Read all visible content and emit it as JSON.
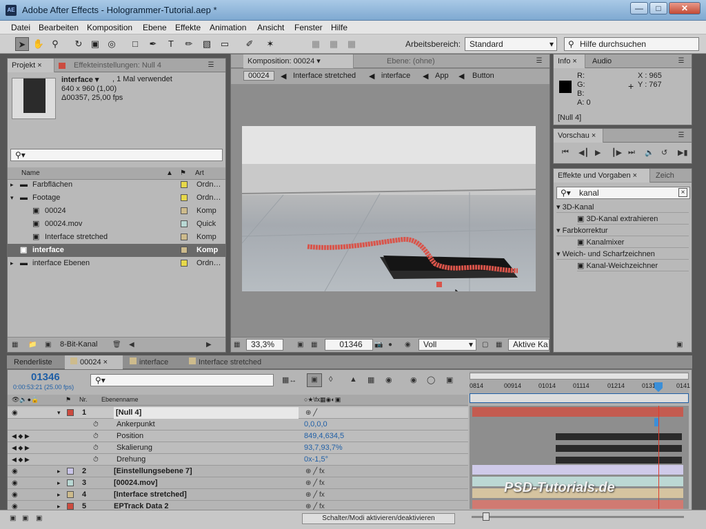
{
  "window": {
    "title": "Adobe After Effects - Hologrammer-Tutorial.aep *",
    "icon_text": "AE"
  },
  "menu": [
    "Datei",
    "Bearbeiten",
    "Komposition",
    "Ebene",
    "Effekte",
    "Animation",
    "Ansicht",
    "Fenster",
    "Hilfe"
  ],
  "toolbar": {
    "workspace_label": "Arbeitsbereich:",
    "workspace_value": "Standard",
    "help_placeholder": "Hilfe durchsuchen"
  },
  "project": {
    "tab_label": "Projekt",
    "effects_tab_label": "Effekteinstellungen: Null 4",
    "item_name": "interface ▾",
    "item_usage": ", 1 Mal verwendet",
    "item_dims": "640 x 960 (1,00)",
    "item_duration": "Δ00357, 25,00 fps",
    "search_placeholder": "",
    "col_name": "Name",
    "col_type": "Art",
    "rows": [
      {
        "label": "Farbflächen",
        "type": "Ordn…",
        "color": "#e6d84a"
      },
      {
        "label": "Footage",
        "type": "Ordn…",
        "color": "#e6d84a"
      },
      {
        "label": "00024",
        "type": "Komp",
        "color": "#cdbb8c"
      },
      {
        "label": "00024.mov",
        "type": "Quick",
        "color": "#b9d8d4"
      },
      {
        "label": "Interface stretched",
        "type": "Komp",
        "color": "#cdbb8c"
      },
      {
        "label": "interface",
        "type": "Komp",
        "color": "#cdbb8c"
      },
      {
        "label": "interface Ebenen",
        "type": "Ordn…",
        "color": "#e6d84a"
      }
    ],
    "footer_bitdepth": "8-Bit-Kanal"
  },
  "composition": {
    "tab_label": "Komposition: 00024",
    "layer_tab_label": "Ebene: (ohne)",
    "breadcrumb": [
      "00024",
      "Interface stretched",
      "interface",
      "App",
      "Button"
    ],
    "zoom": "33,3%",
    "timecode": "01346",
    "quality": "Voll",
    "camera": "Aktive Ka"
  },
  "info": {
    "tab_label": "Info",
    "audio_tab_label": "Audio",
    "r_label": "R:",
    "g_label": "G:",
    "b_label": "B:",
    "a_label": "A: 0",
    "x_label": "X : 965",
    "y_label": "Y : 767",
    "layer": "[Null 4]"
  },
  "preview": {
    "tab_label": "Vorschau"
  },
  "effects": {
    "tab_label": "Effekte und Vorgaben",
    "second_tab_label": "Zeich",
    "search_value": "kanal",
    "tree": [
      {
        "label": "3D-Kanal",
        "kind": "group"
      },
      {
        "label": "3D-Kanal extrahieren",
        "kind": "item"
      },
      {
        "label": "Farbkorrektur",
        "kind": "group"
      },
      {
        "label": "Kanalmixer",
        "kind": "item"
      },
      {
        "label": "Weich- und Scharfzeichnen",
        "kind": "group"
      },
      {
        "label": "Kanal-Weichzeichner",
        "kind": "item"
      }
    ]
  },
  "timeline_tabs": [
    "Renderliste",
    "00024",
    "interface",
    "Interface stretched"
  ],
  "timeline": {
    "timecode": "01346",
    "subtime": "0:00:53:21 (25.00 fps)",
    "col_nr": "Nr.",
    "col_name": "Ebenenname",
    "ruler": [
      "0814",
      "00914",
      "01014",
      "01114",
      "01214",
      "01314",
      "0141"
    ],
    "layers": [
      {
        "nr": "1",
        "name": "[Null 4]",
        "color": "#cc4b3f"
      },
      {
        "nr": "",
        "name": "Ankerpunkt",
        "value": "0,0,0,0",
        "prop": true
      },
      {
        "nr": "",
        "name": "Position",
        "value": "849,4,634,5",
        "prop": true
      },
      {
        "nr": "",
        "name": "Skalierung",
        "value": "93,7,93,7%",
        "prop": true
      },
      {
        "nr": "",
        "name": "Drehung",
        "value": "0x-1,5°",
        "prop": true
      },
      {
        "nr": "2",
        "name": "[Einstellungsebene 7]",
        "color": "#c9c4e8"
      },
      {
        "nr": "3",
        "name": "[00024.mov]",
        "color": "#b9d8d4"
      },
      {
        "nr": "4",
        "name": "[Interface stretched]",
        "color": "#cdbb8c"
      },
      {
        "nr": "5",
        "name": "EPTrack Data 2",
        "color": "#cc4b3f"
      }
    ],
    "toggle_label": "Schalter/Modi aktivieren/deaktivieren"
  },
  "watermark": "PSD-Tutorials.de"
}
